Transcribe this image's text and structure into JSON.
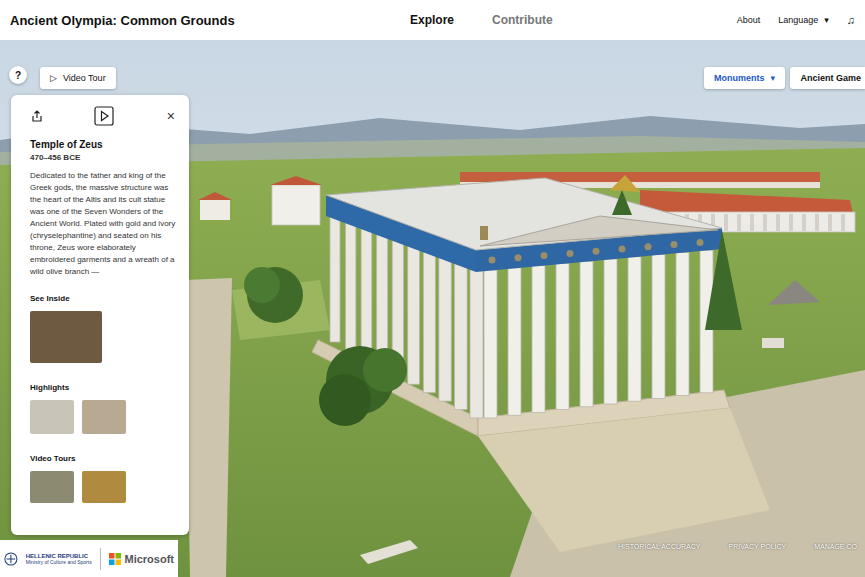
{
  "header": {
    "title": "Ancient Olympia: Common Grounds",
    "nav": [
      {
        "label": "Explore",
        "selected": true
      },
      {
        "label": "Contribute",
        "selected": false
      }
    ],
    "links": [
      "About",
      "Language"
    ],
    "language_caret": "▾",
    "music_icon": "♫"
  },
  "toolbar": {
    "help": "?",
    "video_tour": {
      "icon": "▷",
      "label": "Video Tour"
    },
    "monuments": {
      "label": "Monuments",
      "caret": "▾"
    },
    "games": "Ancient Game"
  },
  "panel": {
    "close": "×",
    "title": "Temple of Zeus",
    "dates": "470–456 BCE",
    "description": "Dedicated to the father and king of the Greek gods, the massive structure was the heart of the Altis and its cult statue was one of the Seven Wonders of the Ancient World. Plated with gold and ivory (chryselephantine) and seated on his throne, Zeus wore elaborately embroidered garments and a wreath of a wild olive branch —",
    "sections": [
      {
        "heading": "See Inside",
        "thumbnails": [
          {
            "color": "#6e5a40"
          }
        ]
      },
      {
        "heading": "Highlights",
        "thumbnails": [
          {
            "color": "#c9c4b8"
          },
          {
            "color": "#b8aa92"
          }
        ]
      },
      {
        "heading": "Video Tours",
        "thumbnails": [
          {
            "color": "#8c8a70"
          },
          {
            "color": "#b08a3e"
          }
        ]
      }
    ]
  },
  "footer": {
    "partners": [
      "HELLENIC REPUBLIC",
      "Ministry of Culture and Sports",
      "Microsoft"
    ],
    "links": [
      "HISTORICAL ACCURACY",
      "PRIVACY POLICY",
      "MANAGE CO"
    ]
  }
}
